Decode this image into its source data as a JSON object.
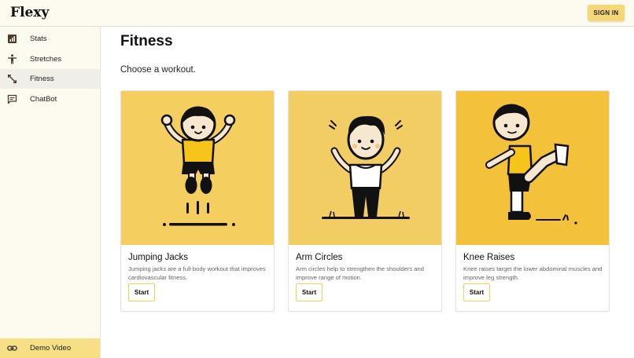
{
  "header": {
    "logo": "Flexy",
    "signin_label": "SIGN IN"
  },
  "sidebar": {
    "items": [
      {
        "label": "Stats",
        "icon": "stats-icon"
      },
      {
        "label": "Stretches",
        "icon": "stretch-person-icon"
      },
      {
        "label": "Fitness",
        "icon": "expand-arrows-icon",
        "active": true
      },
      {
        "label": "ChatBot",
        "icon": "chat-bubble-icon"
      }
    ],
    "demo": {
      "label": "Demo Video",
      "icon": "link-icon"
    }
  },
  "main": {
    "title": "Fitness",
    "subtitle": "Choose a workout.",
    "cards": [
      {
        "title": "Jumping Jacks",
        "description": "Jumping jacks are a full-body workout that improves cardiovascular fitness.",
        "button": "Start",
        "image": "jumping-jacks-illustration",
        "bg": "#f4cf5f"
      },
      {
        "title": "Arm Circles",
        "description": "Arm circles help to strengthen the shoulders and improve range of motion.",
        "button": "Start",
        "image": "arm-circles-illustration",
        "bg": "#f1cd63"
      },
      {
        "title": "Knee Raises",
        "description": "Knee raises target the lower abdominal muscles and improve leg strength.",
        "button": "Start",
        "image": "knee-raises-illustration",
        "bg": "#f4c23a"
      }
    ]
  },
  "colors": {
    "accent": "#f6d777",
    "sidebar_bg": "#fdfaf0",
    "active_bg": "#efeee9",
    "demo_bg": "#f7df86"
  }
}
